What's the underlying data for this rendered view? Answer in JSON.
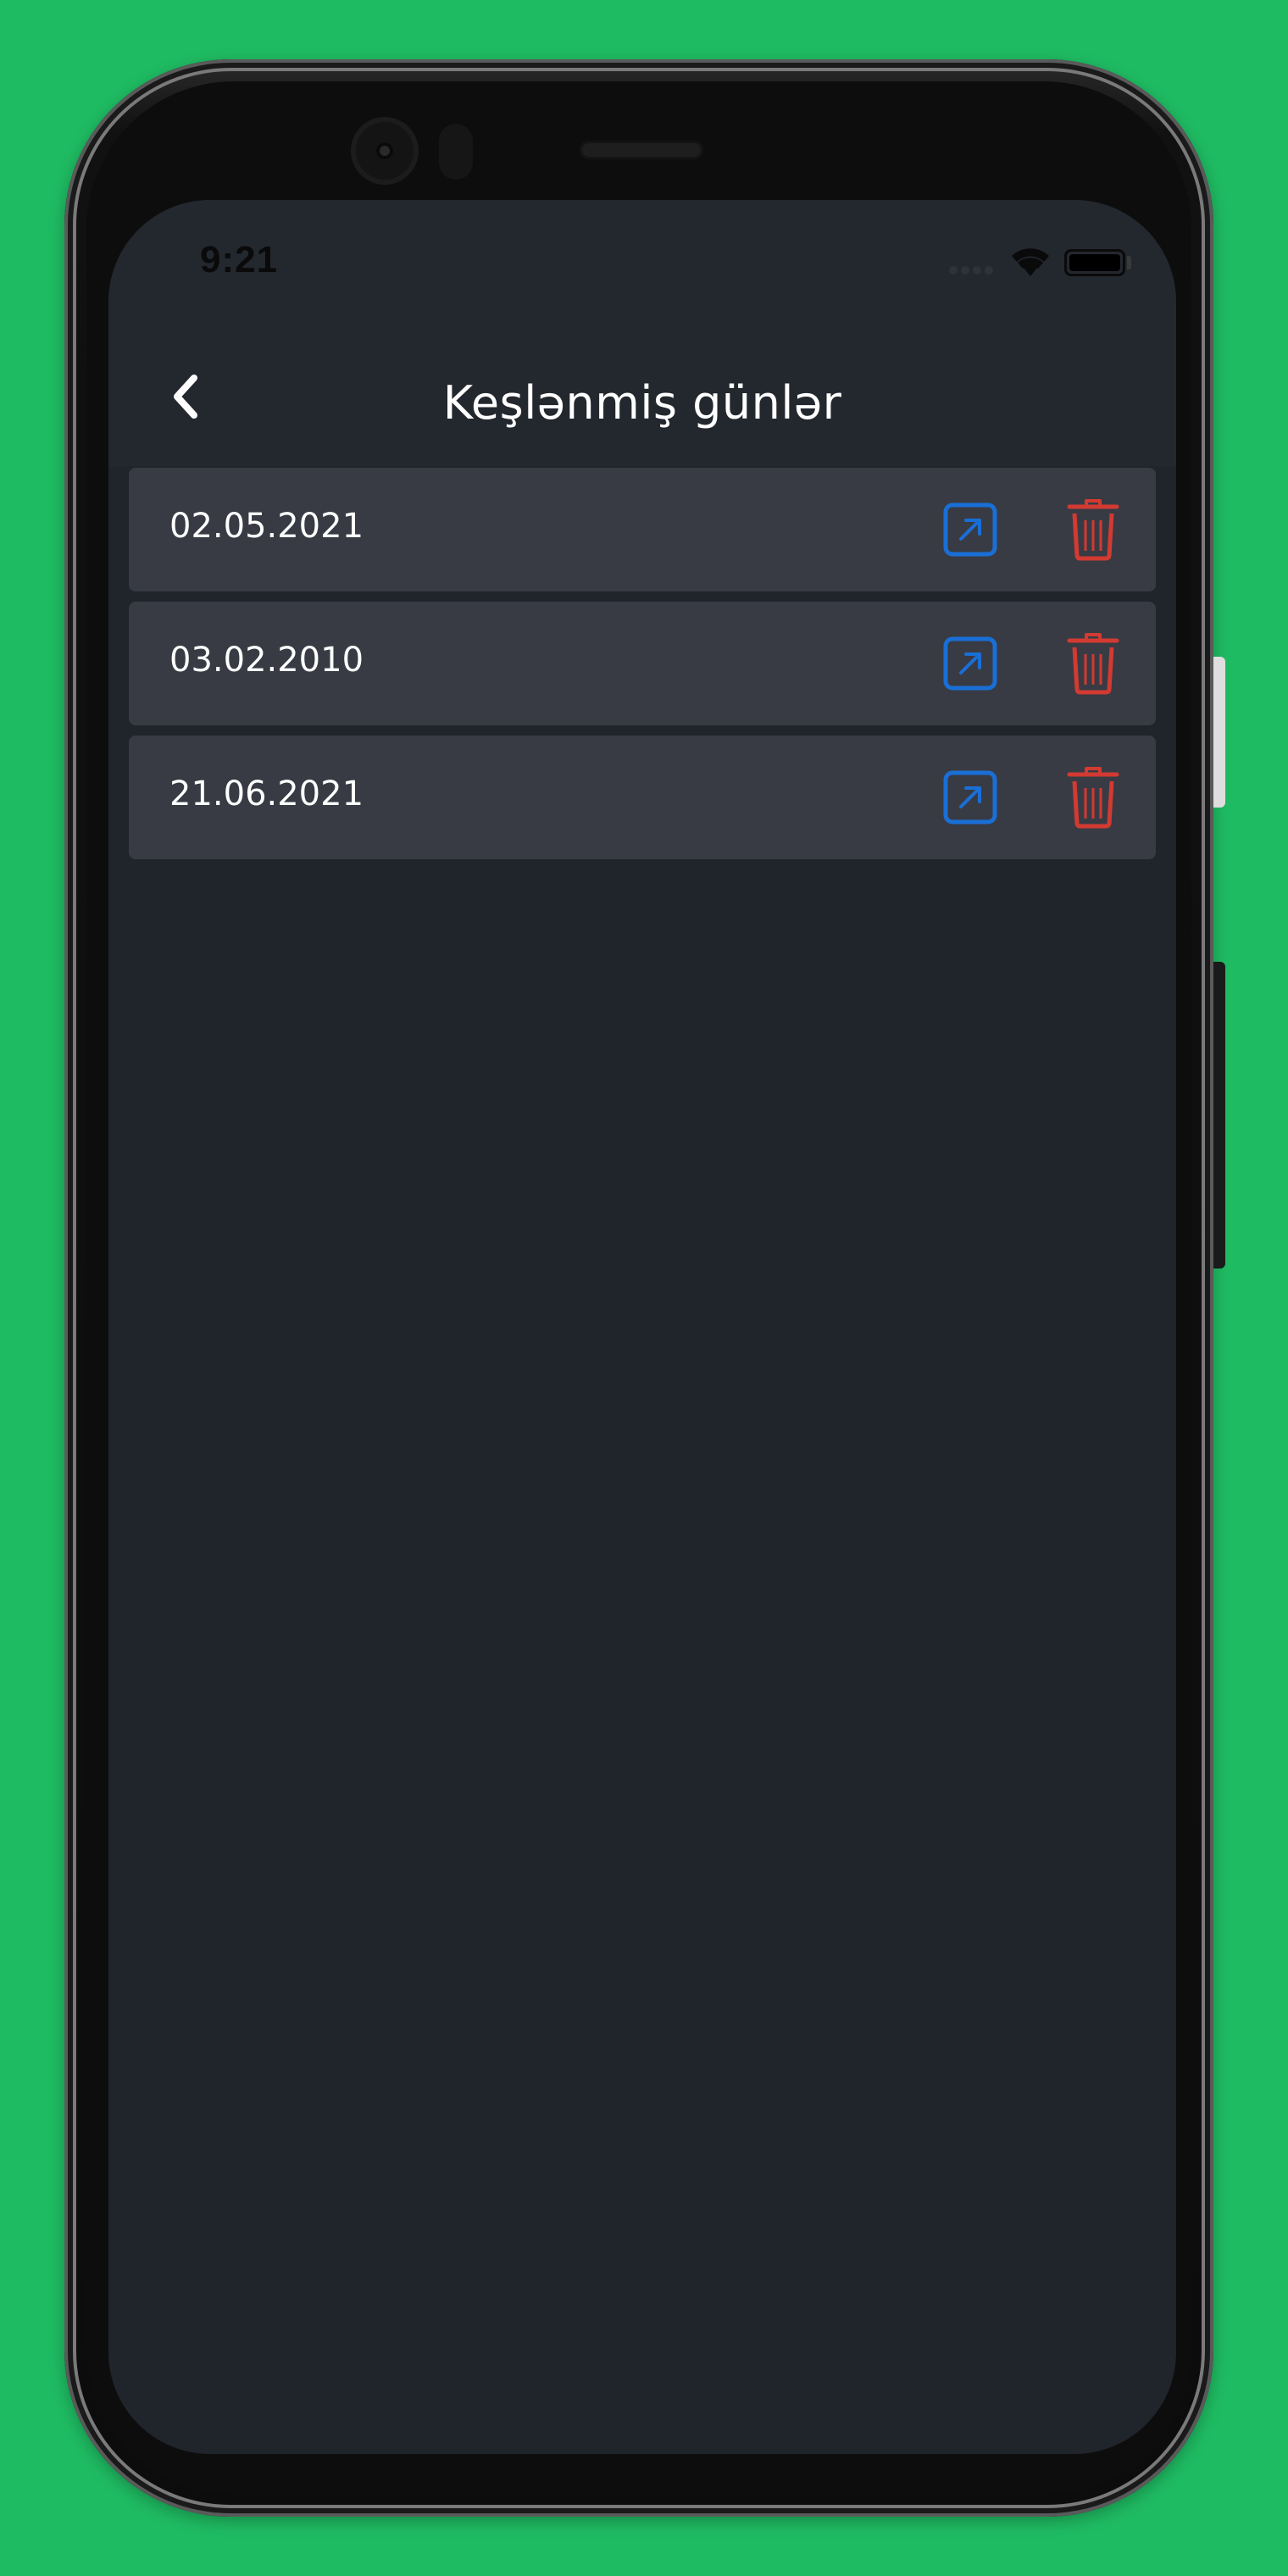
{
  "status_bar": {
    "time": "9:21"
  },
  "header": {
    "title": "Keşlənmiş günlər",
    "back_icon": "chevron-left-icon"
  },
  "cached_days": [
    {
      "date": "02.05.2021",
      "open_icon": "open-external-icon",
      "delete_icon": "trash-icon"
    },
    {
      "date": "03.02.2010",
      "open_icon": "open-external-icon",
      "delete_icon": "trash-icon"
    },
    {
      "date": "21.06.2021",
      "open_icon": "open-external-icon",
      "delete_icon": "trash-icon"
    }
  ],
  "colors": {
    "background": "#1fbb62",
    "screen": "#20242b",
    "row": "#383b44",
    "open_icon": "#1a6fd6",
    "delete_icon": "#d23a32",
    "text": "#ffffff"
  }
}
